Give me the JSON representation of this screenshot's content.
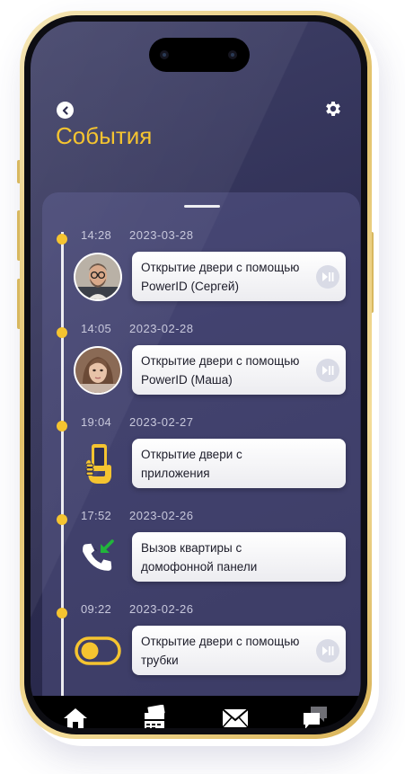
{
  "header": {
    "title": "События",
    "back_icon": "chevron-left-icon",
    "settings_icon": "gear-icon"
  },
  "colors": {
    "accent": "#f5c430",
    "background": "#2f2f55",
    "card": "#ffffff",
    "timeline": "#ffffff"
  },
  "events": [
    {
      "time": "14:28",
      "date": "2023-03-28",
      "text": "Открытие двери с помощью PowerID (Сергей)",
      "icon": "avatar-man",
      "has_play": true
    },
    {
      "time": "14:05",
      "date": "2023-02-28",
      "text": "Открытие двери с помощью PowerID (Маша)",
      "icon": "avatar-woman",
      "has_play": true
    },
    {
      "time": "19:04",
      "date": "2023-02-27",
      "text": "Открытие двери с приложения",
      "icon": "phone-in-hand-icon",
      "has_play": false
    },
    {
      "time": "17:52",
      "date": "2023-02-26",
      "text": "Вызов квартиры с домофонной панели",
      "icon": "incoming-call-icon",
      "has_play": false
    },
    {
      "time": "09:22",
      "date": "2023-02-26",
      "text": "Открытие двери с помощью трубки",
      "icon": "toggle-switch-icon",
      "has_play": true
    }
  ],
  "tabbar": {
    "items": [
      {
        "icon": "home-icon"
      },
      {
        "icon": "cards-icon"
      },
      {
        "icon": "mail-icon"
      },
      {
        "icon": "chat-icon"
      }
    ]
  }
}
